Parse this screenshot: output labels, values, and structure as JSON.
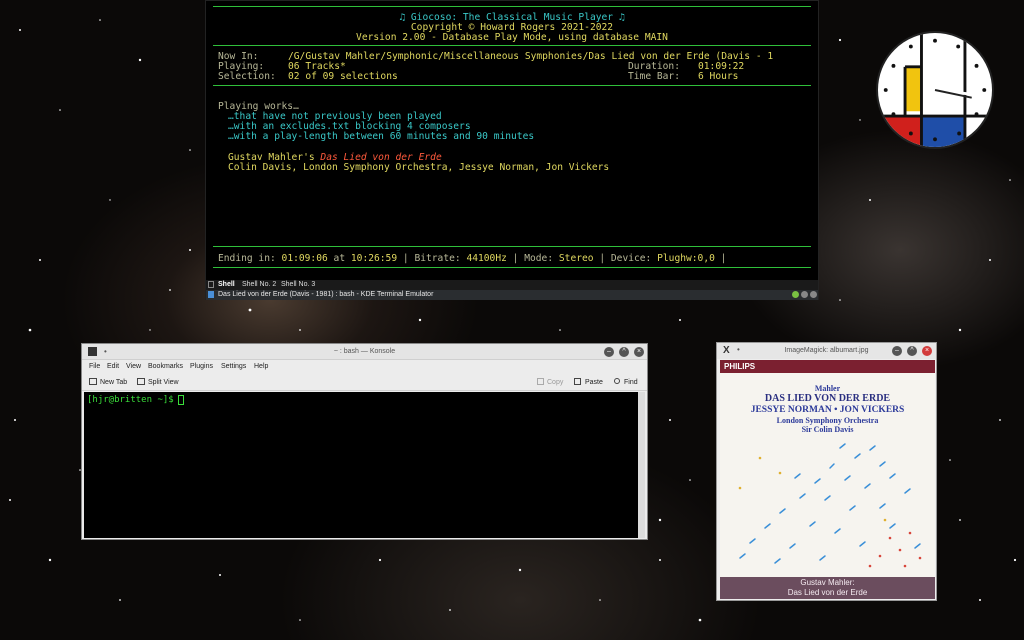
{
  "yakuake": {
    "app_title": "♫ Giocoso: The Classical Music Player ♫",
    "copyright": "Copyright © Howard Rogers 2021-2022",
    "version": "Version 2.00 - Database Play Mode, using database MAIN",
    "now_in_label": "Now In:",
    "now_in_value": "/G/Gustav Mahler/Symphonic/Miscellaneous Symphonies/Das Lied von der Erde (Davis - 1",
    "playing_label": "Playing:",
    "playing_value": "06 Tracks*",
    "duration_label": "Duration:",
    "duration_value": "01:09:22",
    "selection_label": "Selection:",
    "selection_value": "02 of 09 selections",
    "timebar_label": "Time Bar:",
    "timebar_value": "6 Hours",
    "playing_works": "Playing works…",
    "filter_1": "…that have not previously been played",
    "filter_2": "…with an excludes.txt blocking 4 composers",
    "filter_3": "…with a play-length between 60 minutes and 90 minutes",
    "composer": "Gustav Mahler's",
    "work": "Das Lied von der Erde",
    "performers": "Colin Davis, London Symphony Orchestra, Jessye Norman, Jon Vickers",
    "status": {
      "ending_label": "Ending in:",
      "ending_value": "01:09:06",
      "at_label": "at",
      "at_value": "10:26:59",
      "bitrate_label": "Bitrate:",
      "bitrate_value": "44100Hz",
      "mode_label": "Mode:",
      "mode_value": "Stereo",
      "device_label": "Device:",
      "device_value": "Plughw:0,0"
    },
    "tabs": [
      "Shell",
      "Shell No. 2",
      "Shell No. 3"
    ],
    "window_title": "Das Lied von der Erde (Davis - 1981) : bash - KDE Terminal Emulator"
  },
  "konsole": {
    "title": "~ : bash — Konsole",
    "menu": [
      "File",
      "Edit",
      "View",
      "Bookmarks",
      "Plugins",
      "Settings",
      "Help"
    ],
    "new_tab": "New Tab",
    "split_view": "Split View",
    "copy": "Copy",
    "paste": "Paste",
    "find": "Find",
    "prompt": "[hjr@britten ~]$"
  },
  "imagemagick": {
    "title": "ImageMagick: albumart.jpg",
    "label_brand": "PHILIPS",
    "composer": "Mahler",
    "work": "DAS LIED VON DER ERDE",
    "soloists": "JESSYE NORMAN • JON VICKERS",
    "orchestra": "London Symphony Orchestra",
    "conductor": "Sir Colin Davis",
    "caption_line1": "Gustav Mahler:",
    "caption_line2": "Das Lied von der Erde"
  },
  "colors": {
    "terminal_green": "#2fbf3a",
    "terminal_cyan": "#3ac8c8",
    "terminal_yellow": "#e0d860",
    "highlight_red": "#ff5a3c",
    "philips_band": "#7b2030",
    "caption_band": "#6b4d5e"
  }
}
